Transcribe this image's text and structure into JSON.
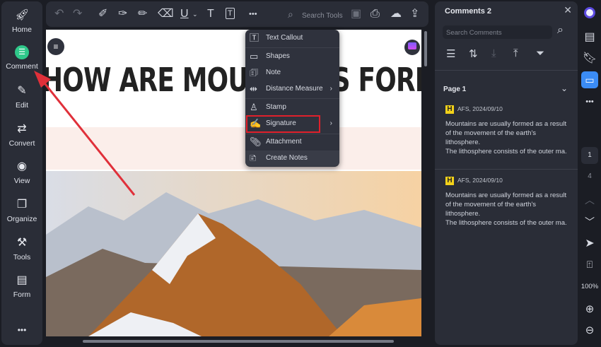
{
  "sidebar": {
    "items": [
      {
        "label": "Home",
        "icon": "rocket-icon"
      },
      {
        "label": "Comment",
        "icon": "comment-icon"
      },
      {
        "label": "Edit",
        "icon": "edit-icon"
      },
      {
        "label": "Convert",
        "icon": "convert-icon"
      },
      {
        "label": "View",
        "icon": "view-icon"
      },
      {
        "label": "Organize",
        "icon": "organize-icon"
      },
      {
        "label": "Tools",
        "icon": "tools-icon"
      },
      {
        "label": "Form",
        "icon": "form-icon"
      }
    ],
    "more": "•••"
  },
  "toolbar": {
    "search_placeholder": "Search Tools",
    "more": "•••"
  },
  "document": {
    "title": "HOW ARE MOUNTAINS FORMED?"
  },
  "menu": {
    "items": [
      {
        "label": "Text Callout"
      },
      {
        "label": "Shapes"
      },
      {
        "label": "Note"
      },
      {
        "label": "Distance Measure",
        "submenu": true
      },
      {
        "label": "Stamp"
      },
      {
        "label": "Signature",
        "submenu": true,
        "highlighted": true
      },
      {
        "label": "Attachment"
      },
      {
        "label": "Create Notes"
      }
    ]
  },
  "comments": {
    "title": "Comments 2",
    "search_placeholder": "Search Comments",
    "page_label": "Page 1",
    "items": [
      {
        "badge": "H",
        "author_date": "AFS,  2024/09/10",
        "lines": [
          "Mountains are usually formed as a result",
          "of the movement of the earth's",
          "lithosphere.",
          "The lithosphere consists of the outer ma..."
        ]
      },
      {
        "badge": "H",
        "author_date": "AFS,  2024/09/10",
        "lines": [
          "Mountains are usually formed as a result",
          "of the movement of the earth's",
          "lithosphere.",
          "The lithosphere consists of the outer ma..."
        ]
      }
    ]
  },
  "rail": {
    "current_page": "1",
    "total_pages": "4",
    "zoom": "100%"
  },
  "colors": {
    "accent": "#3b8cf5",
    "highlight_box": "#e0202b",
    "arrow": "#e0303a",
    "badge": "#f3d11a"
  }
}
